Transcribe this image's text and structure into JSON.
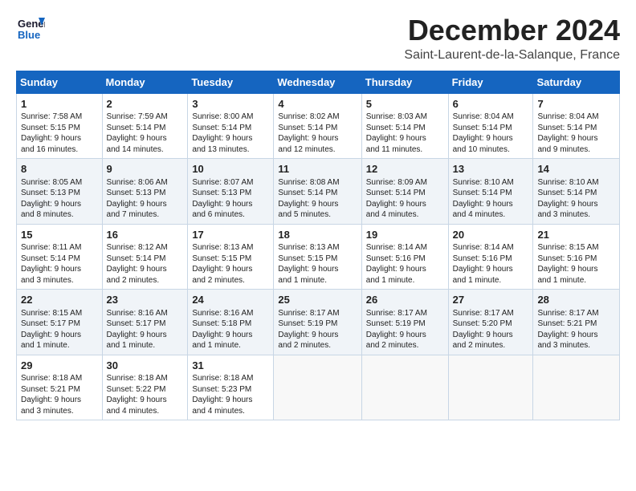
{
  "header": {
    "logo_line1": "General",
    "logo_line2": "Blue",
    "month": "December 2024",
    "location": "Saint-Laurent-de-la-Salanque, France"
  },
  "weekdays": [
    "Sunday",
    "Monday",
    "Tuesday",
    "Wednesday",
    "Thursday",
    "Friday",
    "Saturday"
  ],
  "weeks": [
    [
      {
        "day": "1",
        "lines": [
          "Sunrise: 7:58 AM",
          "Sunset: 5:15 PM",
          "Daylight: 9 hours",
          "and 16 minutes."
        ]
      },
      {
        "day": "2",
        "lines": [
          "Sunrise: 7:59 AM",
          "Sunset: 5:14 PM",
          "Daylight: 9 hours",
          "and 14 minutes."
        ]
      },
      {
        "day": "3",
        "lines": [
          "Sunrise: 8:00 AM",
          "Sunset: 5:14 PM",
          "Daylight: 9 hours",
          "and 13 minutes."
        ]
      },
      {
        "day": "4",
        "lines": [
          "Sunrise: 8:02 AM",
          "Sunset: 5:14 PM",
          "Daylight: 9 hours",
          "and 12 minutes."
        ]
      },
      {
        "day": "5",
        "lines": [
          "Sunrise: 8:03 AM",
          "Sunset: 5:14 PM",
          "Daylight: 9 hours",
          "and 11 minutes."
        ]
      },
      {
        "day": "6",
        "lines": [
          "Sunrise: 8:04 AM",
          "Sunset: 5:14 PM",
          "Daylight: 9 hours",
          "and 10 minutes."
        ]
      },
      {
        "day": "7",
        "lines": [
          "Sunrise: 8:04 AM",
          "Sunset: 5:14 PM",
          "Daylight: 9 hours",
          "and 9 minutes."
        ]
      }
    ],
    [
      {
        "day": "8",
        "lines": [
          "Sunrise: 8:05 AM",
          "Sunset: 5:13 PM",
          "Daylight: 9 hours",
          "and 8 minutes."
        ]
      },
      {
        "day": "9",
        "lines": [
          "Sunrise: 8:06 AM",
          "Sunset: 5:13 PM",
          "Daylight: 9 hours",
          "and 7 minutes."
        ]
      },
      {
        "day": "10",
        "lines": [
          "Sunrise: 8:07 AM",
          "Sunset: 5:13 PM",
          "Daylight: 9 hours",
          "and 6 minutes."
        ]
      },
      {
        "day": "11",
        "lines": [
          "Sunrise: 8:08 AM",
          "Sunset: 5:14 PM",
          "Daylight: 9 hours",
          "and 5 minutes."
        ]
      },
      {
        "day": "12",
        "lines": [
          "Sunrise: 8:09 AM",
          "Sunset: 5:14 PM",
          "Daylight: 9 hours",
          "and 4 minutes."
        ]
      },
      {
        "day": "13",
        "lines": [
          "Sunrise: 8:10 AM",
          "Sunset: 5:14 PM",
          "Daylight: 9 hours",
          "and 4 minutes."
        ]
      },
      {
        "day": "14",
        "lines": [
          "Sunrise: 8:10 AM",
          "Sunset: 5:14 PM",
          "Daylight: 9 hours",
          "and 3 minutes."
        ]
      }
    ],
    [
      {
        "day": "15",
        "lines": [
          "Sunrise: 8:11 AM",
          "Sunset: 5:14 PM",
          "Daylight: 9 hours",
          "and 3 minutes."
        ]
      },
      {
        "day": "16",
        "lines": [
          "Sunrise: 8:12 AM",
          "Sunset: 5:14 PM",
          "Daylight: 9 hours",
          "and 2 minutes."
        ]
      },
      {
        "day": "17",
        "lines": [
          "Sunrise: 8:13 AM",
          "Sunset: 5:15 PM",
          "Daylight: 9 hours",
          "and 2 minutes."
        ]
      },
      {
        "day": "18",
        "lines": [
          "Sunrise: 8:13 AM",
          "Sunset: 5:15 PM",
          "Daylight: 9 hours",
          "and 1 minute."
        ]
      },
      {
        "day": "19",
        "lines": [
          "Sunrise: 8:14 AM",
          "Sunset: 5:16 PM",
          "Daylight: 9 hours",
          "and 1 minute."
        ]
      },
      {
        "day": "20",
        "lines": [
          "Sunrise: 8:14 AM",
          "Sunset: 5:16 PM",
          "Daylight: 9 hours",
          "and 1 minute."
        ]
      },
      {
        "day": "21",
        "lines": [
          "Sunrise: 8:15 AM",
          "Sunset: 5:16 PM",
          "Daylight: 9 hours",
          "and 1 minute."
        ]
      }
    ],
    [
      {
        "day": "22",
        "lines": [
          "Sunrise: 8:15 AM",
          "Sunset: 5:17 PM",
          "Daylight: 9 hours",
          "and 1 minute."
        ]
      },
      {
        "day": "23",
        "lines": [
          "Sunrise: 8:16 AM",
          "Sunset: 5:17 PM",
          "Daylight: 9 hours",
          "and 1 minute."
        ]
      },
      {
        "day": "24",
        "lines": [
          "Sunrise: 8:16 AM",
          "Sunset: 5:18 PM",
          "Daylight: 9 hours",
          "and 1 minute."
        ]
      },
      {
        "day": "25",
        "lines": [
          "Sunrise: 8:17 AM",
          "Sunset: 5:19 PM",
          "Daylight: 9 hours",
          "and 2 minutes."
        ]
      },
      {
        "day": "26",
        "lines": [
          "Sunrise: 8:17 AM",
          "Sunset: 5:19 PM",
          "Daylight: 9 hours",
          "and 2 minutes."
        ]
      },
      {
        "day": "27",
        "lines": [
          "Sunrise: 8:17 AM",
          "Sunset: 5:20 PM",
          "Daylight: 9 hours",
          "and 2 minutes."
        ]
      },
      {
        "day": "28",
        "lines": [
          "Sunrise: 8:17 AM",
          "Sunset: 5:21 PM",
          "Daylight: 9 hours",
          "and 3 minutes."
        ]
      }
    ],
    [
      {
        "day": "29",
        "lines": [
          "Sunrise: 8:18 AM",
          "Sunset: 5:21 PM",
          "Daylight: 9 hours",
          "and 3 minutes."
        ]
      },
      {
        "day": "30",
        "lines": [
          "Sunrise: 8:18 AM",
          "Sunset: 5:22 PM",
          "Daylight: 9 hours",
          "and 4 minutes."
        ]
      },
      {
        "day": "31",
        "lines": [
          "Sunrise: 8:18 AM",
          "Sunset: 5:23 PM",
          "Daylight: 9 hours",
          "and 4 minutes."
        ]
      },
      null,
      null,
      null,
      null
    ]
  ]
}
